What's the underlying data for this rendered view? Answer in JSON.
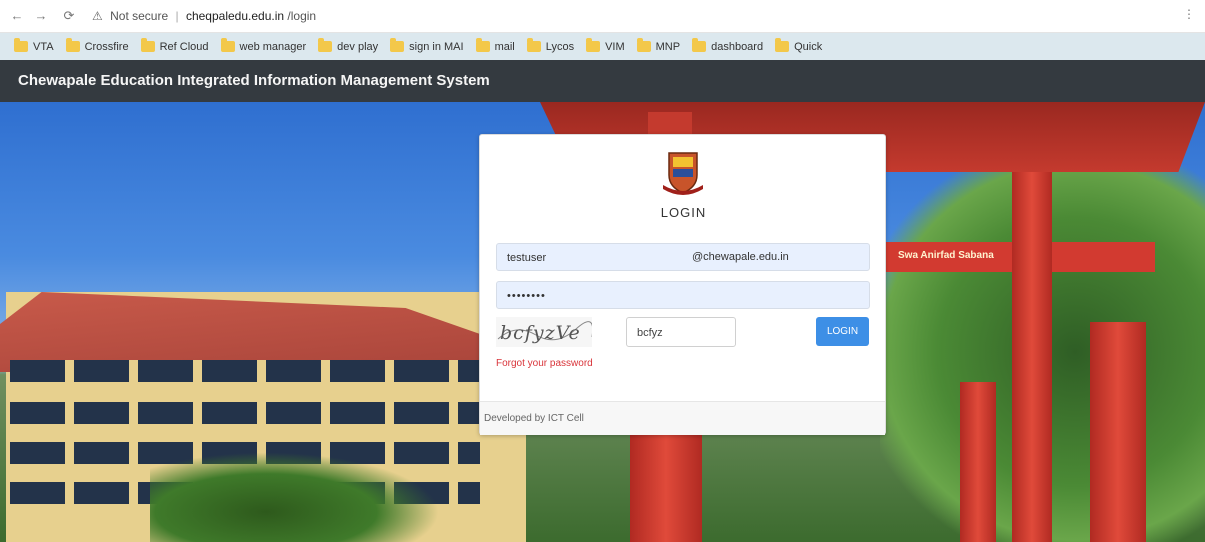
{
  "browser": {
    "url_security": "Not secure",
    "url_host": "cheqpaledu.edu.in",
    "url_path": "/login",
    "bookmarks": [
      {
        "label": "VTA"
      },
      {
        "label": "Crossfire"
      },
      {
        "label": "Ref Cloud"
      },
      {
        "label": "web manager"
      },
      {
        "label": "dev play"
      },
      {
        "label": "sign in MAI"
      },
      {
        "label": "mail"
      },
      {
        "label": "Lycos"
      },
      {
        "label": "VIM"
      },
      {
        "label": "MNP"
      },
      {
        "label": "dashboard"
      },
      {
        "label": "Quick"
      }
    ],
    "menu_icon": "ellipsis-vertical-icon"
  },
  "site": {
    "title": "Chewapale Education Integrated Information Management System"
  },
  "background": {
    "sign_text": "Swa Anirfad Sabana"
  },
  "login": {
    "title": "LOGIN",
    "username_value": "testuser",
    "username_domain": "@chewapale.edu.in",
    "password_value": "••••••••",
    "captcha_text": "bcfyzVe",
    "captcha_input_value": "bcfyz",
    "login_button": "LOGIN",
    "forgot_link": "Forgot your password",
    "footer_text": "Developed by ICT Cell"
  },
  "colors": {
    "header_bg": "#343a40",
    "button_bg": "#3d8fe6",
    "forgot_link": "#d9343a",
    "bookmark_bar": "#dce8ee"
  }
}
